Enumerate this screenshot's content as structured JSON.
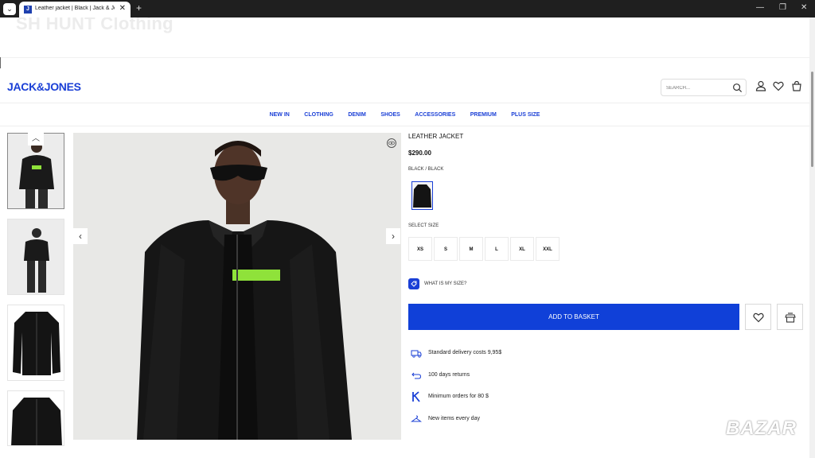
{
  "browser": {
    "tab_title": "Leather jacket | Black | Jack & Jones",
    "tab_close": "✕",
    "new_tab": "+"
  },
  "page": {
    "ghost_title": "SH HUNT Clothing"
  },
  "header": {
    "logo": "JACK&JONES",
    "search_placeholder": "SEARCH..."
  },
  "nav": {
    "items": [
      "NEW IN",
      "CLOTHING",
      "DENIM",
      "SHOES",
      "ACCESSORIES",
      "PREMIUM",
      "PLUS SIZE"
    ]
  },
  "product": {
    "name": "LEATHER JACKET",
    "price": "$290.00",
    "color": "BLACK / BLACK",
    "select_size_label": "SELECT SIZE",
    "sizes": [
      "XS",
      "S",
      "M",
      "L",
      "XL",
      "XXL"
    ],
    "size_help": "WHAT IS MY SIZE?",
    "add_to_basket": "ADD TO BASKET"
  },
  "perks": [
    {
      "icon": "truck-icon",
      "text": "Standard delivery costs 9,95$"
    },
    {
      "icon": "return-icon",
      "text": "100 days returns"
    },
    {
      "icon": "k-icon",
      "text": "Minimum orders for 80 $"
    },
    {
      "icon": "hanger-icon",
      "text": "New items every day"
    }
  ],
  "watermark": "BAZAR",
  "colors": {
    "brand": "#1a3fd6",
    "button": "#1040d8",
    "chrome": "#1f1f1f"
  }
}
